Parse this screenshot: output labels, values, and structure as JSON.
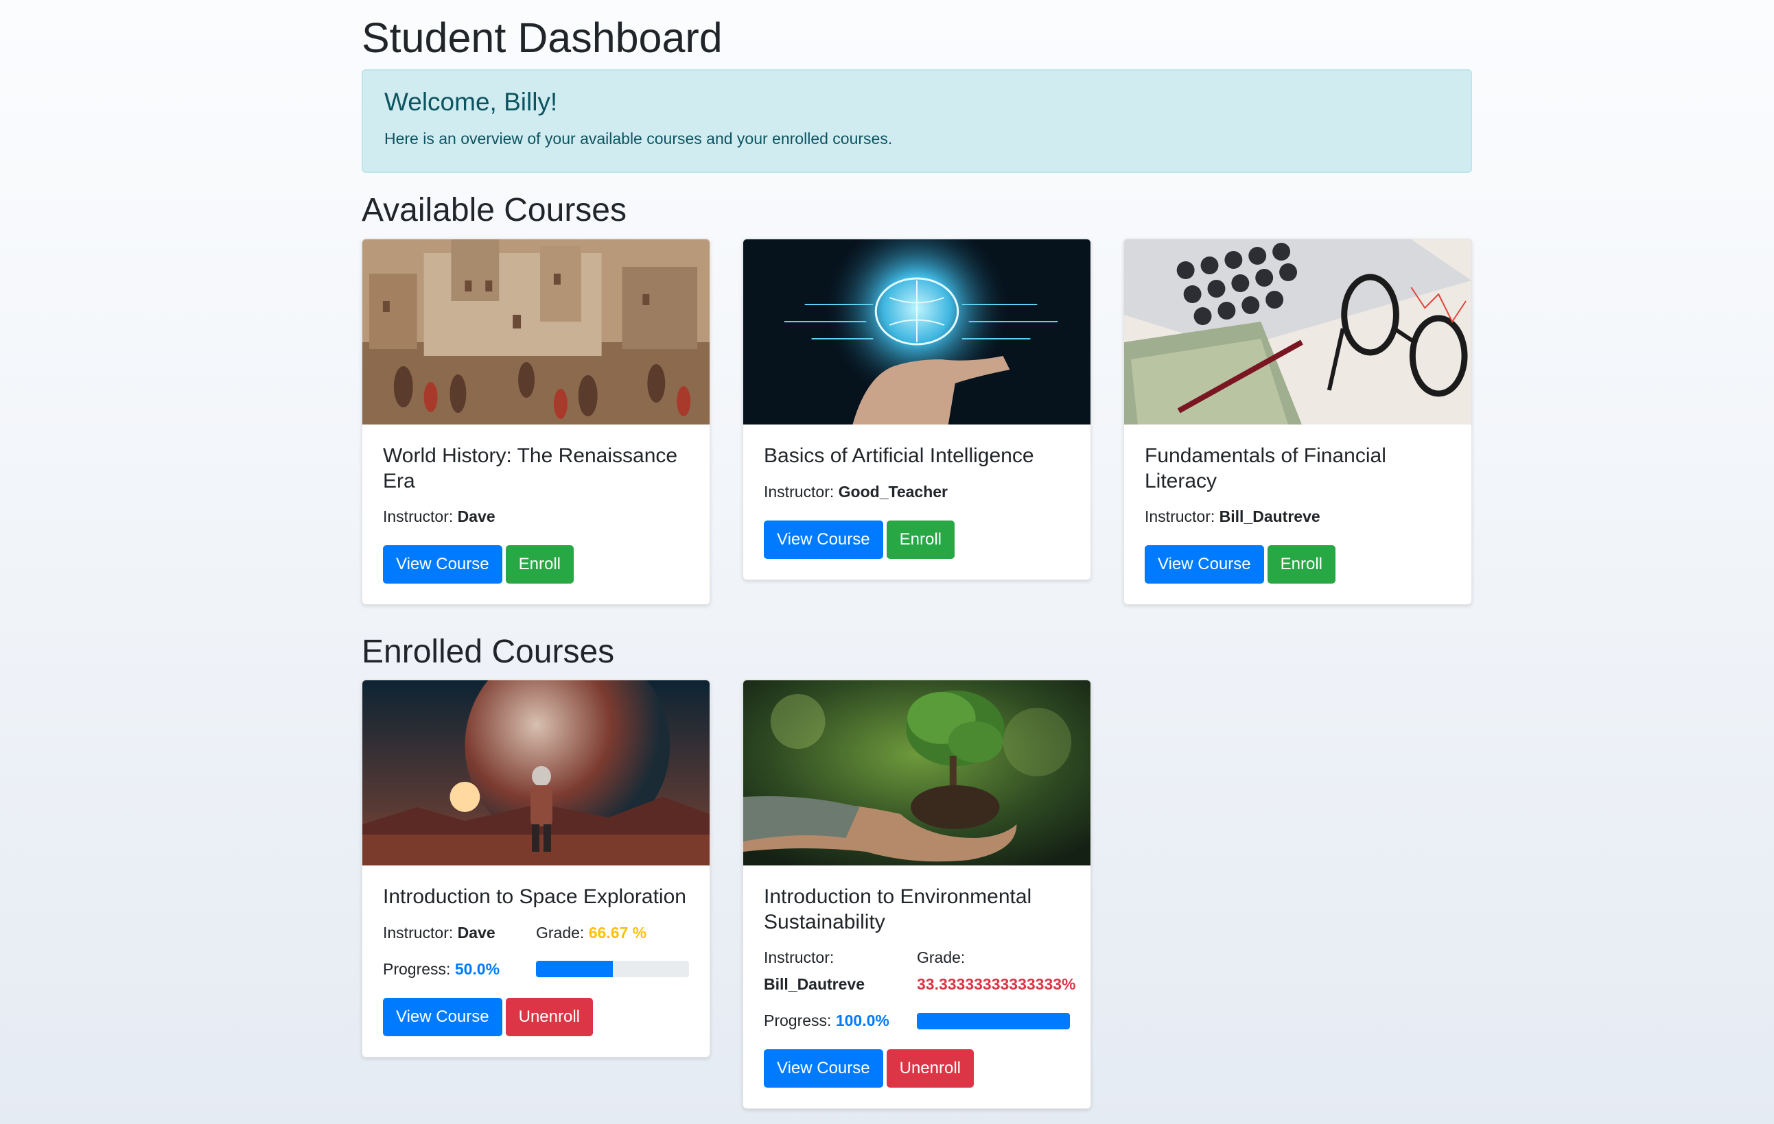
{
  "page": {
    "title": "Student Dashboard"
  },
  "welcome": {
    "heading": "Welcome, Billy!",
    "text": "Here is an overview of your available courses and your enrolled courses."
  },
  "available": {
    "title": "Available Courses",
    "courses": [
      {
        "name": "World History: The Renaissance Era",
        "instructor_label": "Instructor:",
        "instructor": "Dave",
        "view_label": "View Course",
        "enroll_label": "Enroll",
        "image": "renaissance-city-painting"
      },
      {
        "name": "Basics of Artificial Intelligence",
        "instructor_label": "Instructor:",
        "instructor": "Good_Teacher",
        "view_label": "View Course",
        "enroll_label": "Enroll",
        "image": "glowing-brain-hand"
      },
      {
        "name": "Fundamentals of Financial Literacy",
        "instructor_label": "Instructor:",
        "instructor": "Bill_Dautreve",
        "view_label": "View Course",
        "enroll_label": "Enroll",
        "image": "calculator-money-glasses"
      }
    ]
  },
  "enrolled": {
    "title": "Enrolled Courses",
    "courses": [
      {
        "name": "Introduction to Space Exploration",
        "instructor_label": "Instructor:",
        "instructor": "Dave",
        "grade_label": "Grade:",
        "grade": "66.67 %",
        "progress_label": "Progress:",
        "progress": "50.0%",
        "progress_value": 0.5,
        "view_label": "View Course",
        "unenroll_label": "Unenroll",
        "image": "astronaut-planet",
        "grade_color": "#ffc107"
      },
      {
        "name": "Introduction to Environmental Sustainability",
        "instructor_label": "Instructor:",
        "instructor": "Bill_Dautreve",
        "grade_label": "Grade:",
        "grade": "33.33333333333333%",
        "progress_label": "Progress:",
        "progress": "100.0%",
        "progress_value": 1.0,
        "view_label": "View Course",
        "unenroll_label": "Unenroll",
        "image": "hands-holding-tree",
        "grade_color": "#dc3545"
      }
    ]
  },
  "colors": {
    "primary": "#007bff",
    "success": "#28a745",
    "danger": "#dc3545",
    "warning": "#ffc107",
    "info_bg": "#d1ecf1"
  }
}
